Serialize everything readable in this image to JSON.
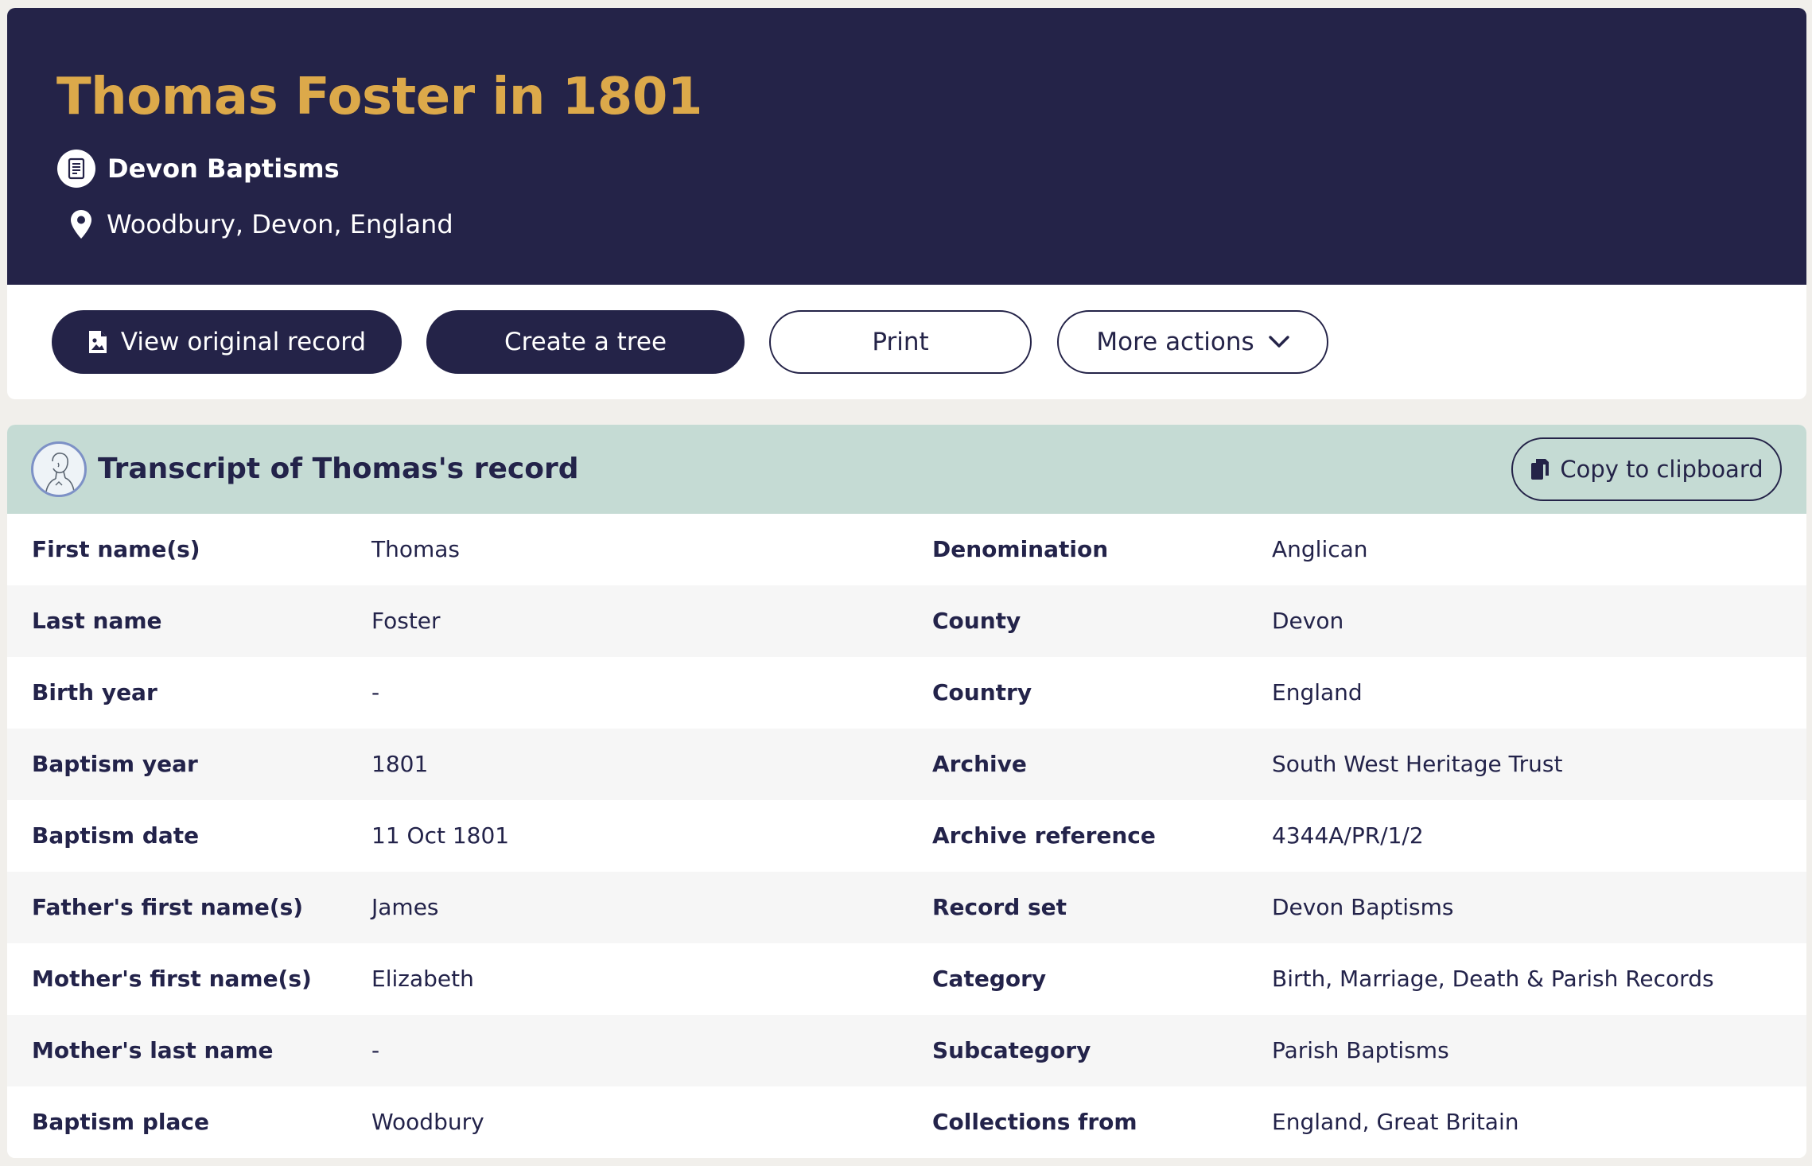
{
  "header": {
    "title": "Thomas Foster in 1801",
    "collection": "Devon Baptisms",
    "location": "Woodbury, Devon, England",
    "colors": {
      "background": "#242348",
      "title": "#dca94a"
    }
  },
  "actions": {
    "view_original": "View original record",
    "create_tree": "Create a tree",
    "print": "Print",
    "more_actions": "More actions"
  },
  "transcript": {
    "title": "Transcript of Thomas's record",
    "copy_label": "Copy to clipboard",
    "rows": [
      {
        "label1": "First name(s)",
        "value1": "Thomas",
        "label2": "Denomination",
        "value2": "Anglican"
      },
      {
        "label1": "Last name",
        "value1": "Foster",
        "label2": "County",
        "value2": "Devon"
      },
      {
        "label1": "Birth year",
        "value1": "-",
        "label2": "Country",
        "value2": "England"
      },
      {
        "label1": "Baptism year",
        "value1": "1801",
        "label2": "Archive",
        "value2": "South West Heritage Trust"
      },
      {
        "label1": "Baptism date",
        "value1": "11 Oct 1801",
        "label2": "Archive reference",
        "value2": "4344A/PR/1/2"
      },
      {
        "label1": "Father's first name(s)",
        "value1": "James",
        "label2": "Record set",
        "value2": "Devon Baptisms"
      },
      {
        "label1": "Mother's first name(s)",
        "value1": "Elizabeth",
        "label2": "Category",
        "value2": "Birth, Marriage, Death & Parish Records"
      },
      {
        "label1": "Mother's last name",
        "value1": "-",
        "label2": "Subcategory",
        "value2": "Parish Baptisms"
      },
      {
        "label1": "Baptism place",
        "value1": "Woodbury",
        "label2": "Collections from",
        "value2": "England, Great Britain"
      }
    ],
    "colors": {
      "header": "#c5dbd4",
      "row_alt": "#f6f6f6"
    }
  },
  "icons": {
    "collection": "document-icon",
    "location": "map-pin-icon",
    "view_original": "image-file-icon",
    "more_actions": "chevron-down-icon",
    "copy": "copy-icon",
    "avatar": "person-sketch-icon"
  }
}
